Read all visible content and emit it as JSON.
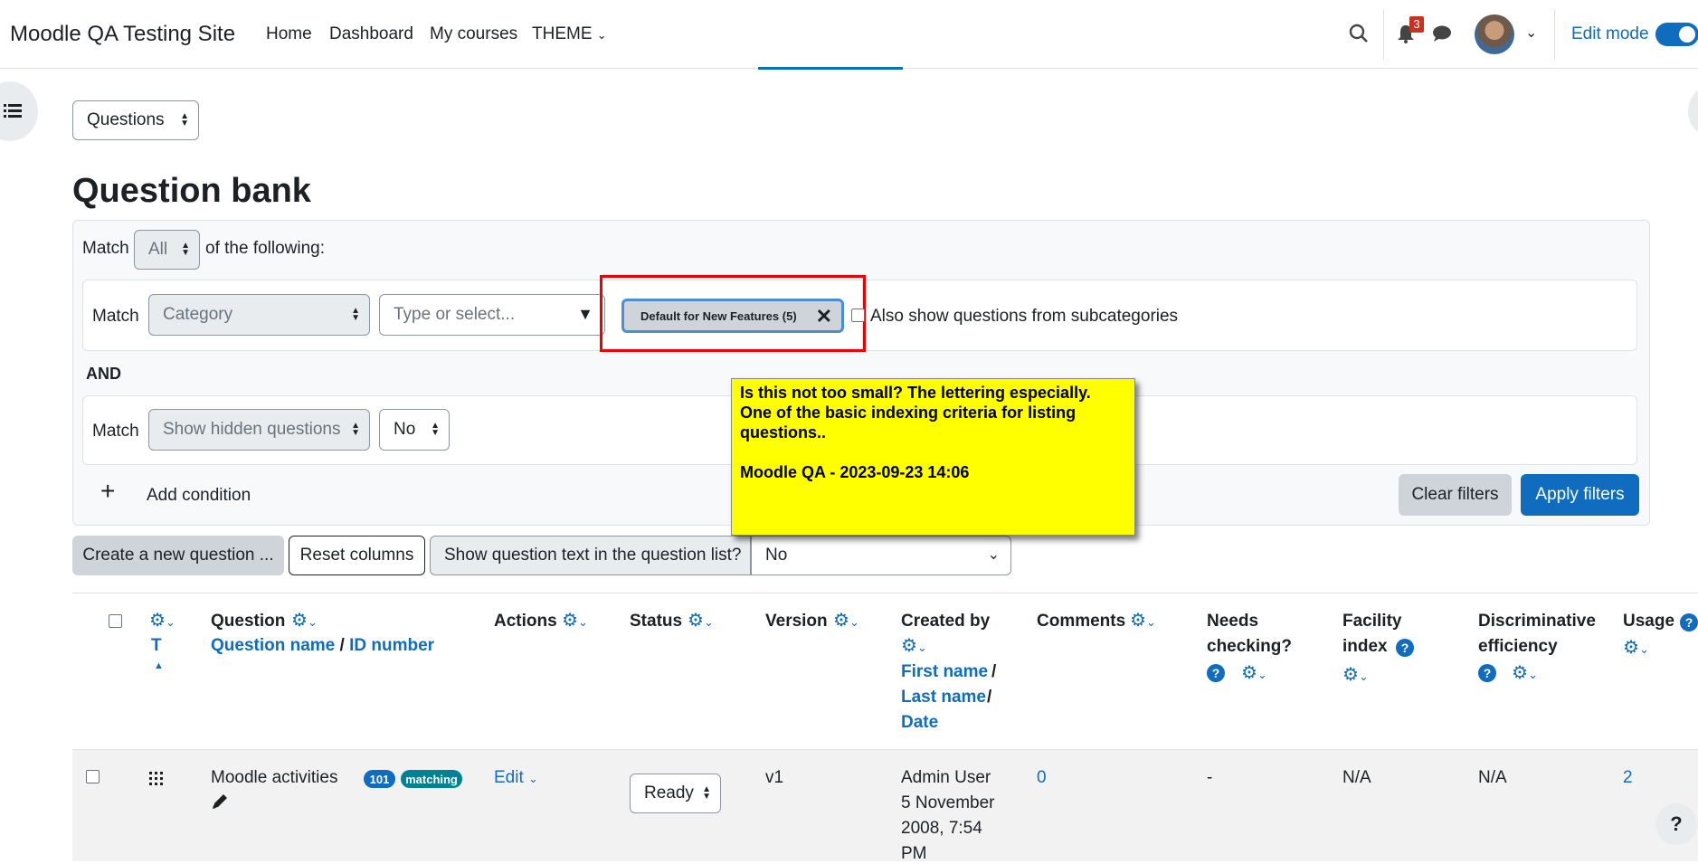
{
  "navbar": {
    "site_name": "Moodle QA Testing Site",
    "links": [
      "Home",
      "Dashboard",
      "My courses",
      "THEME"
    ],
    "notification_count": "3",
    "edit_mode_label": "Edit mode"
  },
  "page_select": "Questions",
  "title": "Question bank",
  "filter": {
    "match_label": "Match",
    "match_value": "All",
    "of_following": "of the following:",
    "row1": {
      "match": "Match",
      "type": "Category",
      "placeholder": "Type or select...",
      "chip": "Default for New Features (5)",
      "subcat_label": "Also show questions from subcategories"
    },
    "and_label": "AND",
    "row2": {
      "match": "Match",
      "type": "Show hidden questions",
      "value": "No"
    },
    "add_condition": "Add condition",
    "clear": "Clear filters",
    "apply": "Apply filters"
  },
  "sticky_note": {
    "lines": [
      "Is this not too small? The lettering especially.",
      "One of the basic indexing criteria for listing",
      "questions.."
    ],
    "signature": "Moodle QA - 2023-09-23 14:06"
  },
  "toolbar": {
    "create": "Create a new question ...",
    "reset": "Reset columns",
    "show_text_label": "Show question text in the question list?",
    "show_text_value": "No"
  },
  "table": {
    "headers": {
      "t": "T",
      "question": "Question",
      "question_name": "Question name",
      "slash": "/",
      "id_number": "ID number",
      "actions": "Actions",
      "status": "Status",
      "version": "Version",
      "created_by": "Created by",
      "first_name": "First name",
      "last_name": "Last name",
      "date": "Date",
      "comments": "Comments",
      "needs_checking_1": "Needs",
      "needs_checking_2": "checking?",
      "facility_1": "Facility",
      "facility_2": "index",
      "discrim_1": "Discriminative",
      "discrim_2": "efficiency",
      "usage": "Usage"
    },
    "row": {
      "name": "Moodle activities",
      "tag_id": "101",
      "tag_type": "matching",
      "edit": "Edit",
      "status": "Ready",
      "version": "v1",
      "created_lines": [
        "Admin User",
        "5 November",
        "2008, 7:54",
        "PM"
      ],
      "comments": "0",
      "needs_checking": "-",
      "facility": "N/A",
      "discrim": "N/A",
      "usage": "2"
    }
  },
  "icons": [
    "search-icon",
    "bell-icon",
    "chat-icon",
    "gear-icon",
    "help-icon",
    "drag-icon",
    "pencil-icon",
    "close-icon",
    "plus-icon",
    "list-icon"
  ]
}
